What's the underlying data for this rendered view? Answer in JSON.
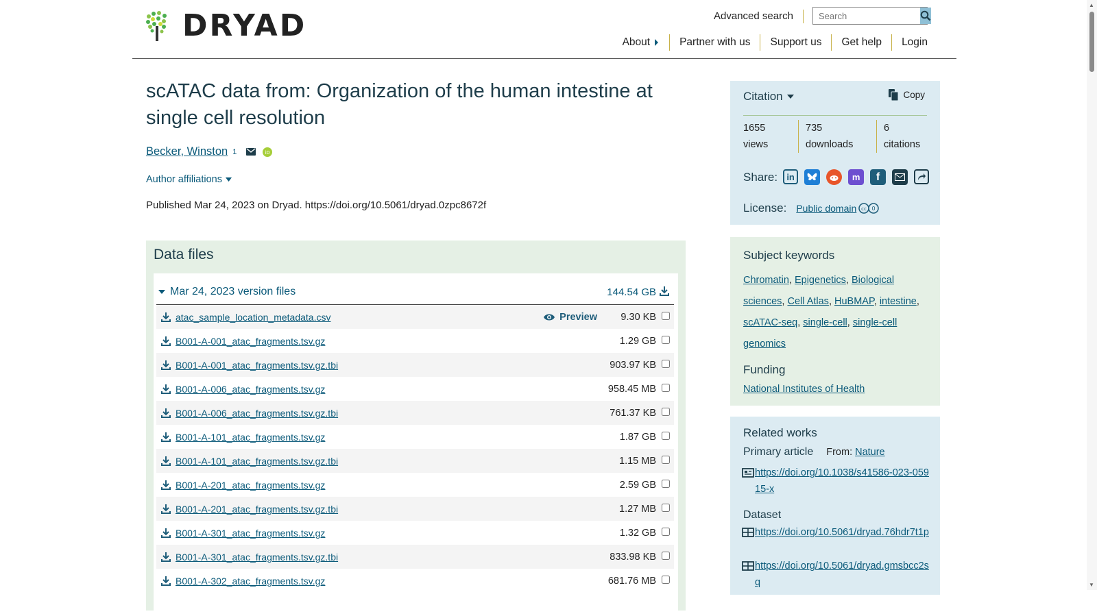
{
  "header": {
    "logo_text": "DRYAD",
    "advanced_search": "Advanced search",
    "search_placeholder": "Search",
    "nav": [
      "About",
      "Partner with us",
      "Support us",
      "Get help",
      "Login"
    ]
  },
  "dataset": {
    "title": "scATAC data from: Organization of the human intestine at single cell resolution",
    "author": "Becker, Winston",
    "author_sup": "1",
    "author_affiliations": "Author affiliations",
    "published": "Published Mar 24, 2023 on Dryad. https://doi.org/10.5061/dryad.0zpc8672f"
  },
  "data_files": {
    "heading": "Data files",
    "version_label": "Mar 24, 2023 version files",
    "version_size": "144.54 GB",
    "preview_label": "Preview",
    "files": [
      {
        "name": "atac_sample_location_metadata.csv",
        "size": "9.30 KB",
        "preview": true
      },
      {
        "name": "B001-A-001_atac_fragments.tsv.gz",
        "size": "1.29 GB"
      },
      {
        "name": "B001-A-001_atac_fragments.tsv.gz.tbi",
        "size": "903.97 KB"
      },
      {
        "name": "B001-A-006_atac_fragments.tsv.gz",
        "size": "958.45 MB"
      },
      {
        "name": "B001-A-006_atac_fragments.tsv.gz.tbi",
        "size": "761.37 KB"
      },
      {
        "name": "B001-A-101_atac_fragments.tsv.gz",
        "size": "1.87 GB"
      },
      {
        "name": "B001-A-101_atac_fragments.tsv.gz.tbi",
        "size": "1.15 MB"
      },
      {
        "name": "B001-A-201_atac_fragments.tsv.gz",
        "size": "2.59 GB"
      },
      {
        "name": "B001-A-201_atac_fragments.tsv.gz.tbi",
        "size": "1.27 MB"
      },
      {
        "name": "B001-A-301_atac_fragments.tsv.gz",
        "size": "1.32 GB"
      },
      {
        "name": "B001-A-301_atac_fragments.tsv.gz.tbi",
        "size": "833.98 KB"
      },
      {
        "name": "B001-A-302_atac_fragments.tsv.gz",
        "size": "681.76 MB"
      }
    ]
  },
  "citation": {
    "title": "Citation",
    "copy": "Copy",
    "views": "1655",
    "views_label": "views",
    "downloads": "735",
    "downloads_label": "downloads",
    "citations": "6",
    "citations_label": "citations",
    "share_label": "Share:",
    "share_icons": [
      "linkedin-icon",
      "bluesky-icon",
      "reddit-icon",
      "mastodon-icon",
      "facebook-icon",
      "email-icon",
      "share-icon"
    ],
    "license_label": "License:",
    "license_link": "Public domain"
  },
  "keywords": {
    "title": "Subject keywords",
    "items": [
      "Chromatin",
      "Epigenetics",
      "Biological sciences",
      "Cell Atlas",
      "HuBMAP",
      "intestine",
      "scATAC-seq",
      "single-cell",
      "single-cell genomics"
    ],
    "funding_title": "Funding",
    "funding_link": "National Institutes of Health"
  },
  "related": {
    "title": "Related works",
    "primary_label": "Primary article",
    "from_label": "From:",
    "from_link": "Nature",
    "primary_url": "https://doi.org/10.1038/s41586-023-05915-x",
    "dataset_label": "Dataset",
    "dataset_urls": [
      "https://doi.org/10.5061/dryad.76hdr7t1p",
      "https://doi.org/10.5061/dryad.gmsbcc2sq"
    ]
  },
  "colors": {
    "link": "#0b5a7a",
    "citation_bg": "#dcebf2",
    "datafiles_bg": "#e5f0e5",
    "accent_rule": "#c8b24a"
  }
}
